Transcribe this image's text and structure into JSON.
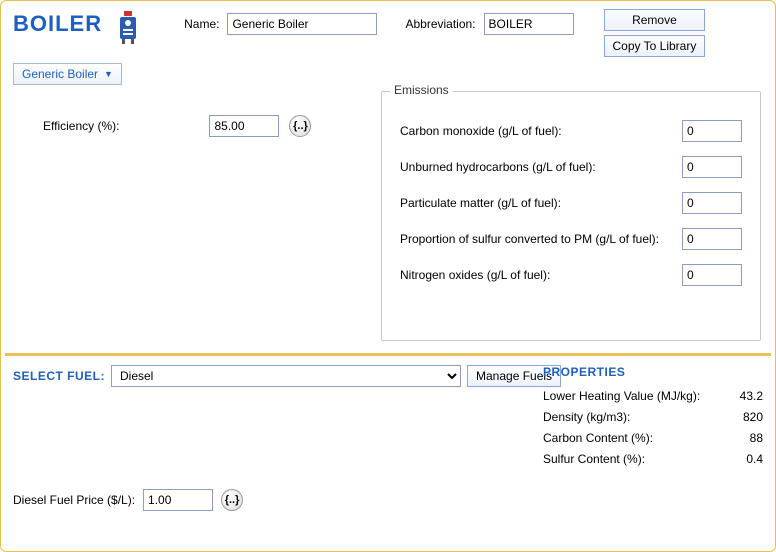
{
  "header": {
    "title": "BOILER",
    "name_label": "Name:",
    "name_value": "Generic Boiler",
    "abbr_label": "Abbreviation:",
    "abbr_value": "BOILER",
    "remove_label": "Remove",
    "copy_label": "Copy To Library",
    "dropdown_value": "Generic Boiler"
  },
  "efficiency": {
    "label": "Efficiency (%):",
    "value": "85.00",
    "sens_glyph": "{..}"
  },
  "emissions": {
    "legend": "Emissions",
    "rows": [
      {
        "label": "Carbon monoxide (g/L of fuel):",
        "value": "0"
      },
      {
        "label": "Unburned hydrocarbons (g/L of fuel):",
        "value": "0"
      },
      {
        "label": "Particulate matter (g/L of fuel):",
        "value": "0"
      },
      {
        "label": "Proportion of sulfur converted to PM (g/L of fuel):",
        "value": "0"
      },
      {
        "label": "Nitrogen oxides (g/L of fuel):",
        "value": "0"
      }
    ]
  },
  "fuel": {
    "select_label": "SELECT FUEL:",
    "selected": "Diesel",
    "manage_label": "Manage Fuels"
  },
  "properties": {
    "header": "PROPERTIES",
    "rows": [
      {
        "label": "Lower Heating Value (MJ/kg):",
        "value": "43.2"
      },
      {
        "label": "Density (kg/m3):",
        "value": "820"
      },
      {
        "label": "Carbon Content (%):",
        "value": "88"
      },
      {
        "label": "Sulfur Content (%):",
        "value": "0.4"
      }
    ]
  },
  "price": {
    "label": "Diesel Fuel Price ($/L):",
    "value": "1.00",
    "sens_glyph": "{..}"
  }
}
